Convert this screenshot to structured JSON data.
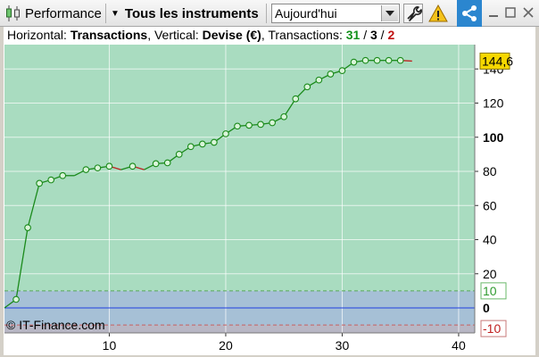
{
  "toolbar": {
    "performance_label": "Performance",
    "instruments_label": "Tous les instruments",
    "period_value": "Aujourd'hui"
  },
  "icons": {
    "chart_type": "candlestick-icon",
    "instruments_chevron": "chevron-down-icon",
    "period_arrow": "dropdown-arrow-icon",
    "settings": "wrench-icon",
    "warning": "warning-icon",
    "share": "share-icon",
    "minimize": "minimize-icon",
    "maximize": "maximize-icon",
    "close": "close-icon"
  },
  "colors": {
    "share_bg": "#2b86cf",
    "profit_zone": "#a9dcc0",
    "loss_zone": "#a6c0d6",
    "line_up": "#1a8a1a",
    "line_down": "#c02020",
    "zero_line": "#1f3ee0"
  },
  "legend": {
    "h_prefix": "Horizontal: ",
    "h_value": "Transactions",
    "v_prefix": ", Vertical: ",
    "v_value": "Devise (€)",
    "t_prefix": ", Transactions: ",
    "winners": "31",
    "sep1": " / ",
    "neutral": "3",
    "sep2": " / ",
    "losers": "2"
  },
  "copyright": "© IT-Finance.com",
  "chart_data": {
    "type": "line",
    "title": "",
    "xlabel": "Transactions",
    "ylabel": "Devise (€)",
    "xlim": [
      1,
      41
    ],
    "ylim": [
      -14,
      150
    ],
    "x_ticks": [
      "10",
      "20",
      "30",
      "40"
    ],
    "y_ticks": [
      "20",
      "40",
      "60",
      "80",
      "100",
      "120",
      "140"
    ],
    "y_ticks_values": [
      20,
      40,
      60,
      80,
      100,
      120,
      140
    ],
    "last_value_label": "144,6",
    "upper_threshold_label": "10",
    "upper_threshold": 10,
    "zero_label": "0",
    "lower_threshold_label": "-10",
    "lower_threshold": -10,
    "series": [
      {
        "x": [
          1,
          2,
          3,
          4,
          5,
          6,
          7,
          8,
          9,
          10,
          11,
          12,
          13,
          14,
          15,
          16,
          17,
          18,
          19,
          20,
          21,
          22,
          23,
          24,
          25,
          26,
          27,
          28,
          29,
          30,
          31,
          32,
          33,
          34,
          35,
          36
        ],
        "values": [
          0,
          5,
          47,
          73,
          75,
          77.5,
          77.5,
          81,
          82,
          83,
          81,
          83,
          81,
          84.5,
          85,
          90,
          94.5,
          96,
          97,
          102,
          106.5,
          107,
          107.5,
          108.5,
          112,
          122.5,
          129.5,
          133.5,
          137,
          139,
          144,
          145,
          145,
          145,
          145,
          144.6
        ],
        "markers": [
          false,
          true,
          true,
          true,
          true,
          true,
          false,
          true,
          true,
          true,
          false,
          true,
          false,
          true,
          true,
          true,
          true,
          true,
          true,
          true,
          true,
          true,
          true,
          true,
          true,
          true,
          true,
          true,
          true,
          true,
          true,
          true,
          true,
          true,
          true,
          false
        ]
      }
    ]
  }
}
